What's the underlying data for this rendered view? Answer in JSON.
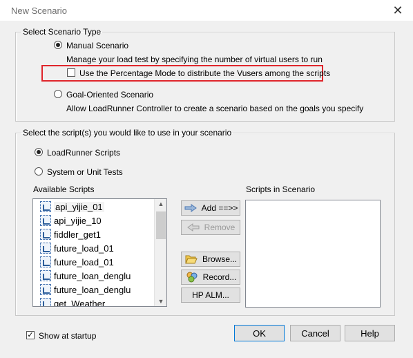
{
  "window": {
    "title": "New Scenario",
    "close_glyph": "✕"
  },
  "scenario_type": {
    "legend": "Select Scenario Type",
    "manual": {
      "label": "Manual Scenario",
      "description": "Manage your load test by specifying the number of virtual users to run",
      "selected": true
    },
    "percentage_mode": {
      "label": "Use the Percentage Mode to distribute the Vusers among the scripts",
      "checked": false
    },
    "goal": {
      "label": "Goal-Oriented Scenario",
      "description": "Allow LoadRunner Controller to create a scenario based on the goals you specify",
      "selected": false
    }
  },
  "scripts": {
    "legend": "Select the script(s) you would like to use in your scenario",
    "loadrunner_label": "LoadRunner Scripts",
    "system_label": "System or Unit Tests",
    "available_label": "Available Scripts",
    "in_scenario_label": "Scripts in Scenario",
    "available": [
      "api_yijie_01",
      "api_yijie_10",
      "fiddler_get1",
      "future_load_01",
      "future_load_01",
      "future_loan_denglu",
      "future_loan_denglu",
      "get_Weather"
    ],
    "in_scenario": []
  },
  "actions": {
    "add": "Add ==>>",
    "remove": "Remove",
    "browse": "Browse...",
    "record": "Record...",
    "hp_alm": "HP ALM..."
  },
  "footer": {
    "show_at_startup": "Show at startup",
    "show_checked": true,
    "ok": "OK",
    "cancel": "Cancel",
    "help": "Help"
  },
  "colors": {
    "highlight": "#e0252b",
    "title_text": "#6d6d6d"
  }
}
